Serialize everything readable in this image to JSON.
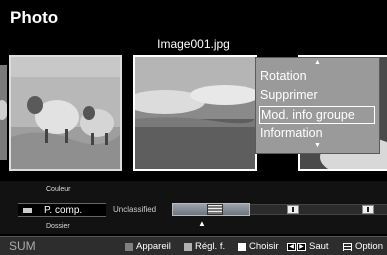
{
  "app": {
    "title": "Photo"
  },
  "viewer": {
    "filename": "Image001.jpg"
  },
  "context_menu": {
    "items": [
      "Rotation",
      "Supprimer",
      "Mod. info groupe",
      "Information"
    ],
    "selected_index": 2
  },
  "sort_bar": {
    "above": "Couleur",
    "current": "P. comp.",
    "below": "Dossier",
    "group_label": "Unclassified"
  },
  "footer": {
    "sum": "SUM",
    "appareil": {
      "label": "Appareil",
      "color": "#808080"
    },
    "regl": {
      "label": "Régl. f.",
      "color": "#b0b0b0"
    },
    "choisir": {
      "label": "Choisir",
      "color": "#ffffff"
    },
    "saut": "Saut",
    "option": "Option"
  },
  "icons": {
    "skip_left": "skip-left-icon",
    "skip_right": "skip-right-icon",
    "tools": "tools-icon"
  }
}
